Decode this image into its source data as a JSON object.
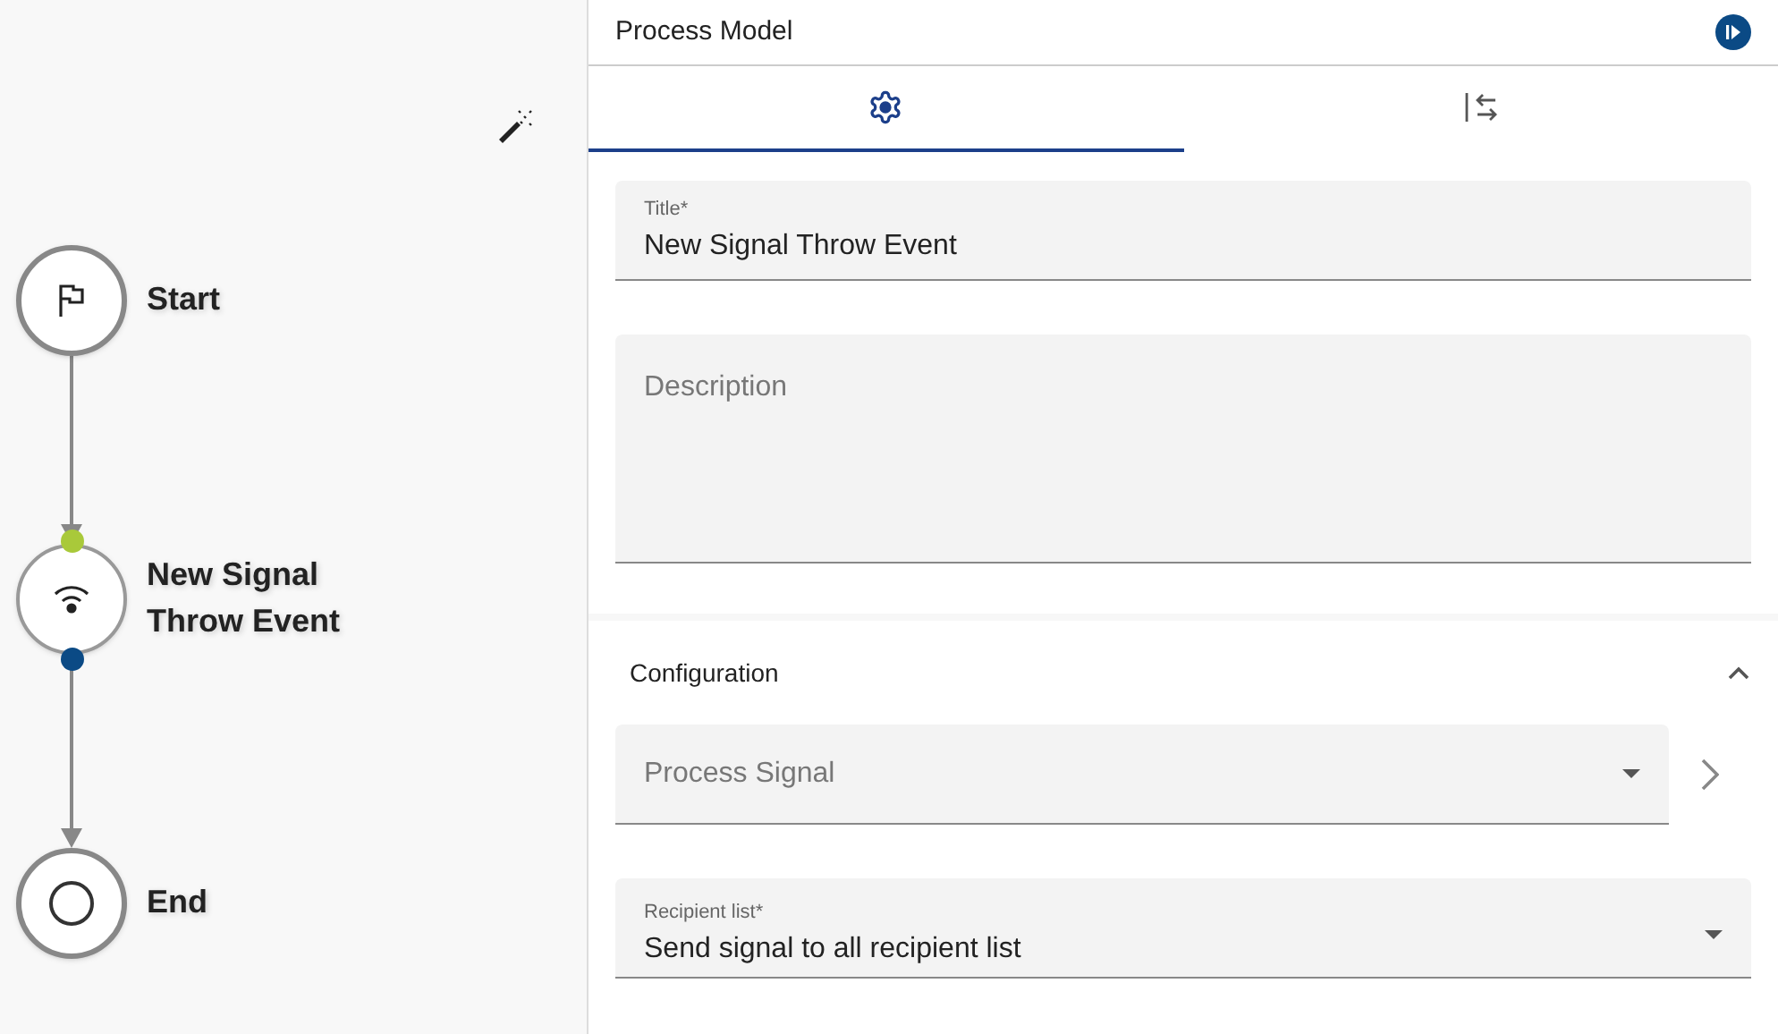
{
  "diagram": {
    "nodes": [
      {
        "kind": "start",
        "label": "Start",
        "selected": false
      },
      {
        "kind": "signal",
        "label": "New Signal Throw Event",
        "selected": true
      },
      {
        "kind": "end",
        "label": "End",
        "selected": false
      }
    ]
  },
  "panel": {
    "title": "Process Model",
    "tabs": [
      {
        "kind": "settings",
        "selected": true
      },
      {
        "kind": "mapping",
        "selected": false
      }
    ],
    "title_field": {
      "label": "Title*",
      "value": "New Signal Throw Event"
    },
    "description_field": {
      "placeholder": "Description"
    },
    "configuration": {
      "title": "Configuration",
      "expanded": true,
      "signal_field": {
        "placeholder": "Process Signal"
      },
      "recipient_field": {
        "label": "Recipient list*",
        "value": "Send signal to all recipient list"
      }
    }
  }
}
